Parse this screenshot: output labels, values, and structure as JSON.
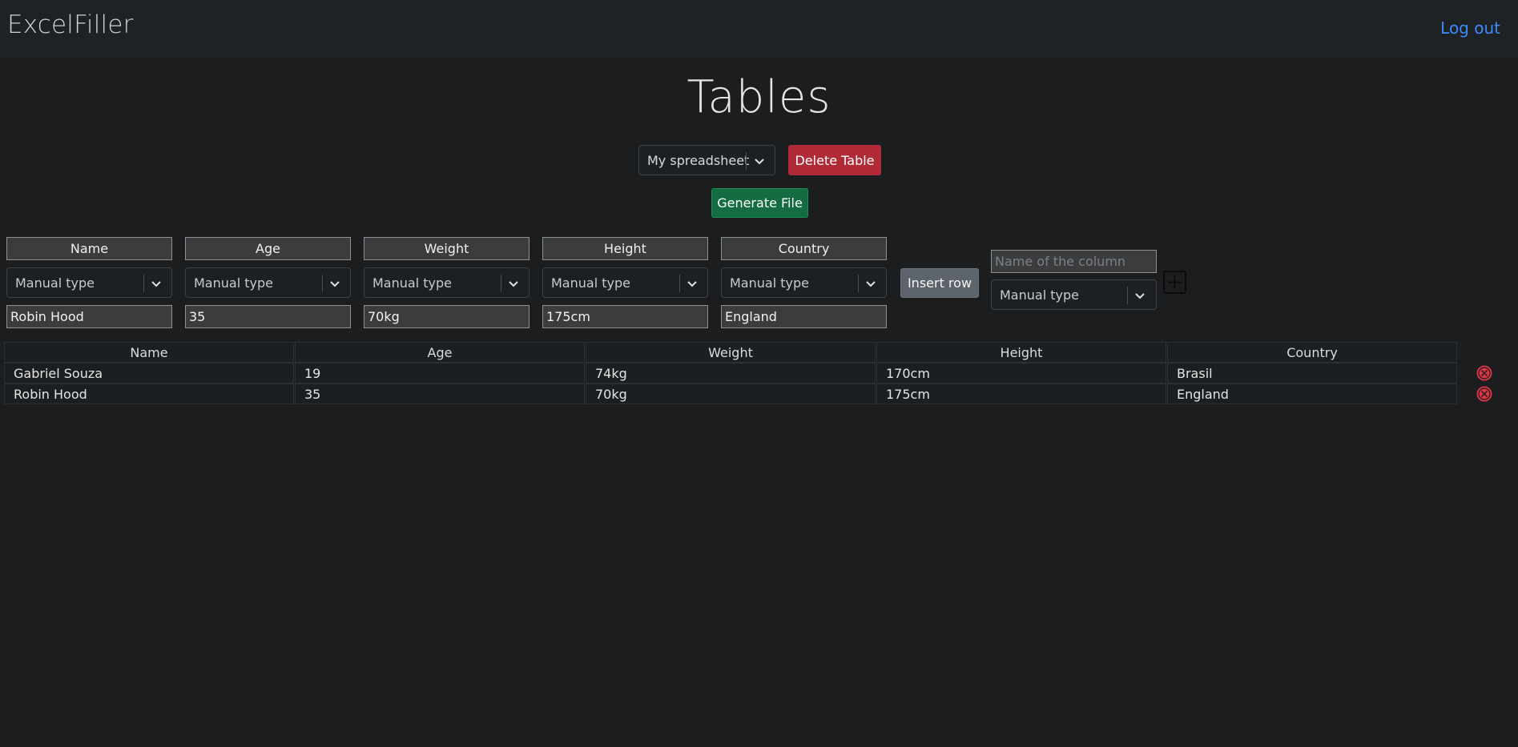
{
  "navbar": {
    "brand": "ExcelFiller",
    "logout": "Log out"
  },
  "page": {
    "title": "Tables"
  },
  "table_select": {
    "selected": "My spreadsheet"
  },
  "buttons": {
    "delete_table": "Delete Table",
    "generate_file": "Generate File",
    "insert_row": "Insert row"
  },
  "columns": [
    {
      "name": "Name",
      "type": "Manual type",
      "value": "Robin Hood"
    },
    {
      "name": "Age",
      "type": "Manual type",
      "value": "35"
    },
    {
      "name": "Weight",
      "type": "Manual type",
      "value": "70kg"
    },
    {
      "name": "Height",
      "type": "Manual type",
      "value": "175cm"
    },
    {
      "name": "Country",
      "type": "Manual type",
      "value": "England"
    }
  ],
  "new_column": {
    "placeholder": "Name of the column",
    "type": "Manual type"
  },
  "table": {
    "headers": [
      "Name",
      "Age",
      "Weight",
      "Height",
      "Country"
    ],
    "rows": [
      [
        "Gabriel Souza",
        "19",
        "74kg",
        "170cm",
        "Brasil"
      ],
      [
        "Robin Hood",
        "35",
        "70kg",
        "175cm",
        "England"
      ]
    ]
  },
  "colors": {
    "background": "#1b1d1f",
    "link": "#3d8bfd",
    "danger": "#b02a37",
    "success": "#146c43",
    "secondary": "#5c636a"
  }
}
